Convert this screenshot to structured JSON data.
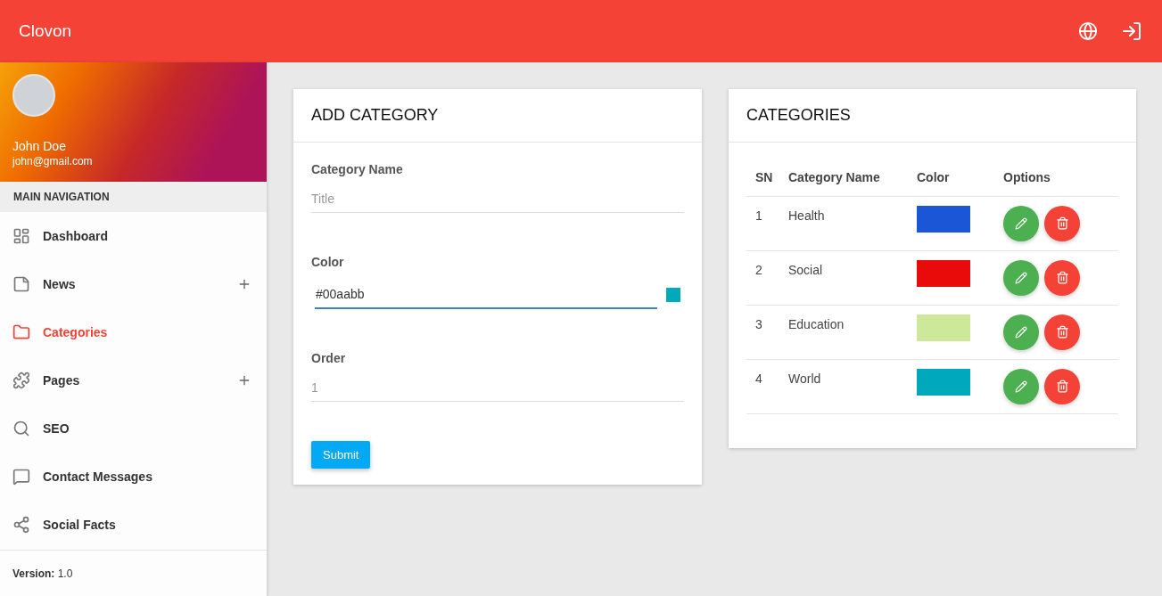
{
  "app_title": "Clovon",
  "user": {
    "name": "John Doe",
    "email": "john@gmail.com"
  },
  "nav_header": "MAIN NAVIGATION",
  "nav_items": [
    {
      "label": "Dashboard",
      "selected": false,
      "has_submenu": false
    },
    {
      "label": "News",
      "selected": false,
      "has_submenu": true
    },
    {
      "label": "Categories",
      "selected": true,
      "has_submenu": false
    },
    {
      "label": "Pages",
      "selected": false,
      "has_submenu": true
    },
    {
      "label": "SEO",
      "selected": false,
      "has_submenu": false
    },
    {
      "label": "Contact Messages",
      "selected": false,
      "has_submenu": false
    },
    {
      "label": "Social Facts",
      "selected": false,
      "has_submenu": false
    }
  ],
  "version": "**Version:** 1.0",
  "add_form": {
    "title": "ADD CATEGORY",
    "fields": [
      {
        "kind": "text",
        "label": "Category Name",
        "placeholder": "Title"
      },
      {
        "kind": "color",
        "label": "Color",
        "value": "#00aabb",
        "color": "#00aabb"
      },
      {
        "kind": "text",
        "label": "Order",
        "placeholder": "1"
      }
    ],
    "submit": "Submit"
  },
  "categories": {
    "title": "CATEGORIES",
    "columns": [
      "SN",
      "Category Name",
      "Color",
      "Options"
    ],
    "rows": [
      {
        "sn": "1",
        "name": "Health",
        "color": "#1a56d6"
      },
      {
        "sn": "2",
        "name": "Social",
        "color": "#e90a0a"
      },
      {
        "sn": "3",
        "name": "Education",
        "color": "#cce899"
      },
      {
        "sn": "4",
        "name": "World",
        "color": "#00a8bb"
      }
    ]
  }
}
